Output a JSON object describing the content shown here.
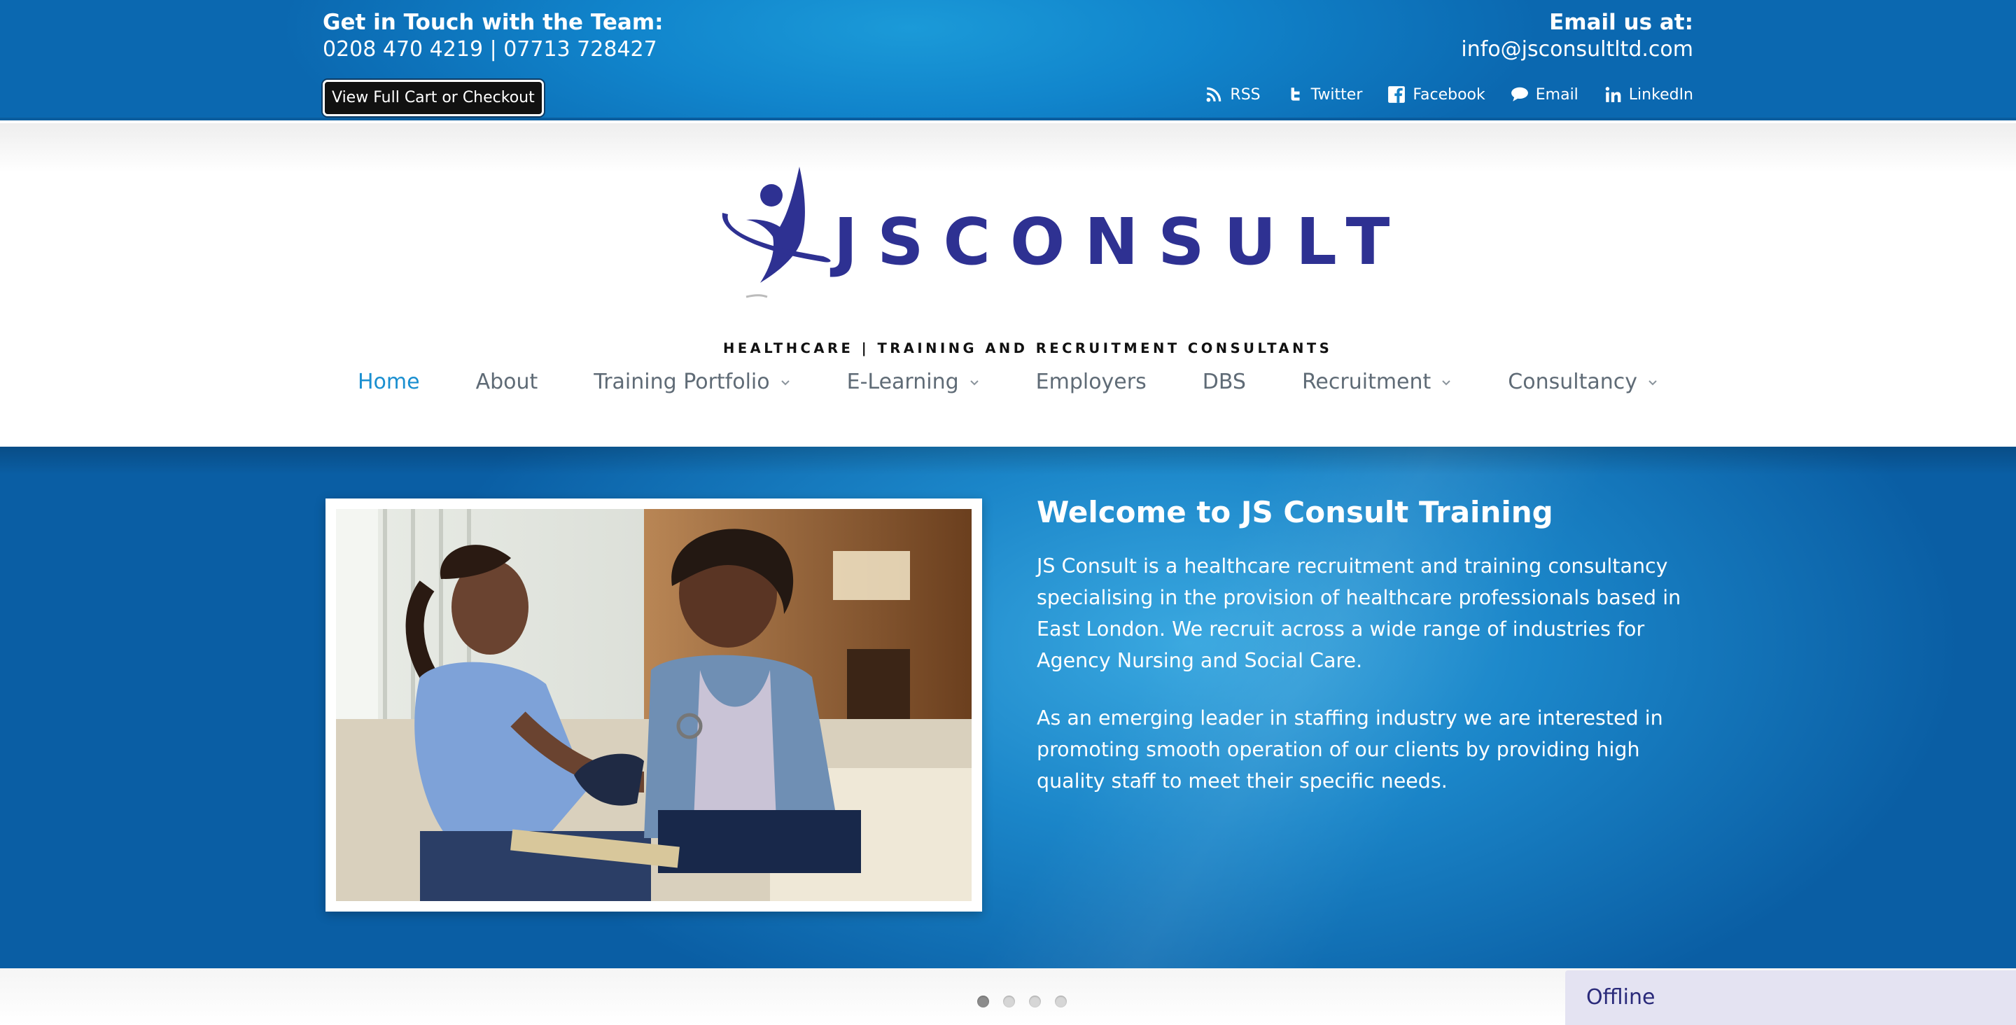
{
  "topbar": {
    "contact_title": "Get in Touch with the Team:",
    "phones": "0208 470 4219 | 07713 728427",
    "cart_button": "View Full Cart or Checkout",
    "email_title": "Email us at:",
    "email": "info@jsconsultltd.com",
    "social": [
      {
        "label": "RSS",
        "icon": "rss-icon"
      },
      {
        "label": "Twitter",
        "icon": "twitter-icon"
      },
      {
        "label": "Facebook",
        "icon": "facebook-icon"
      },
      {
        "label": "Email",
        "icon": "speech-bubble-icon"
      },
      {
        "label": "LinkedIn",
        "icon": "linkedin-icon"
      }
    ]
  },
  "logo": {
    "name": "JSCONSULT",
    "tagline": "HEALTHCARE | TRAINING AND RECRUITMENT CONSULTANTS",
    "color": "#2e3192"
  },
  "nav": {
    "items": [
      {
        "label": "Home",
        "active": true,
        "dropdown": false
      },
      {
        "label": "About",
        "active": false,
        "dropdown": false
      },
      {
        "label": "Training Portfolio",
        "active": false,
        "dropdown": true
      },
      {
        "label": "E-Learning",
        "active": false,
        "dropdown": true
      },
      {
        "label": "Employers",
        "active": false,
        "dropdown": false
      },
      {
        "label": "DBS",
        "active": false,
        "dropdown": false
      },
      {
        "label": "Recruitment",
        "active": false,
        "dropdown": true
      },
      {
        "label": "Consultancy",
        "active": false,
        "dropdown": true
      }
    ],
    "active_color": "#1a8fd0"
  },
  "hero": {
    "title": "Welcome to JS Consult Training",
    "paragraphs": [
      "JS Consult is a healthcare recruitment and training consultancy specialising in the provision of healthcare professionals based in East London. We recruit across a wide range of industries for Agency Nursing and Social Care.",
      "As an emerging leader in staffing industry we are interested in promoting smooth operation of our clients by providing high quality staff to meet their specific needs."
    ]
  },
  "slider": {
    "slide_count": 4,
    "active_index": 0
  },
  "chat": {
    "status": "Offline"
  }
}
